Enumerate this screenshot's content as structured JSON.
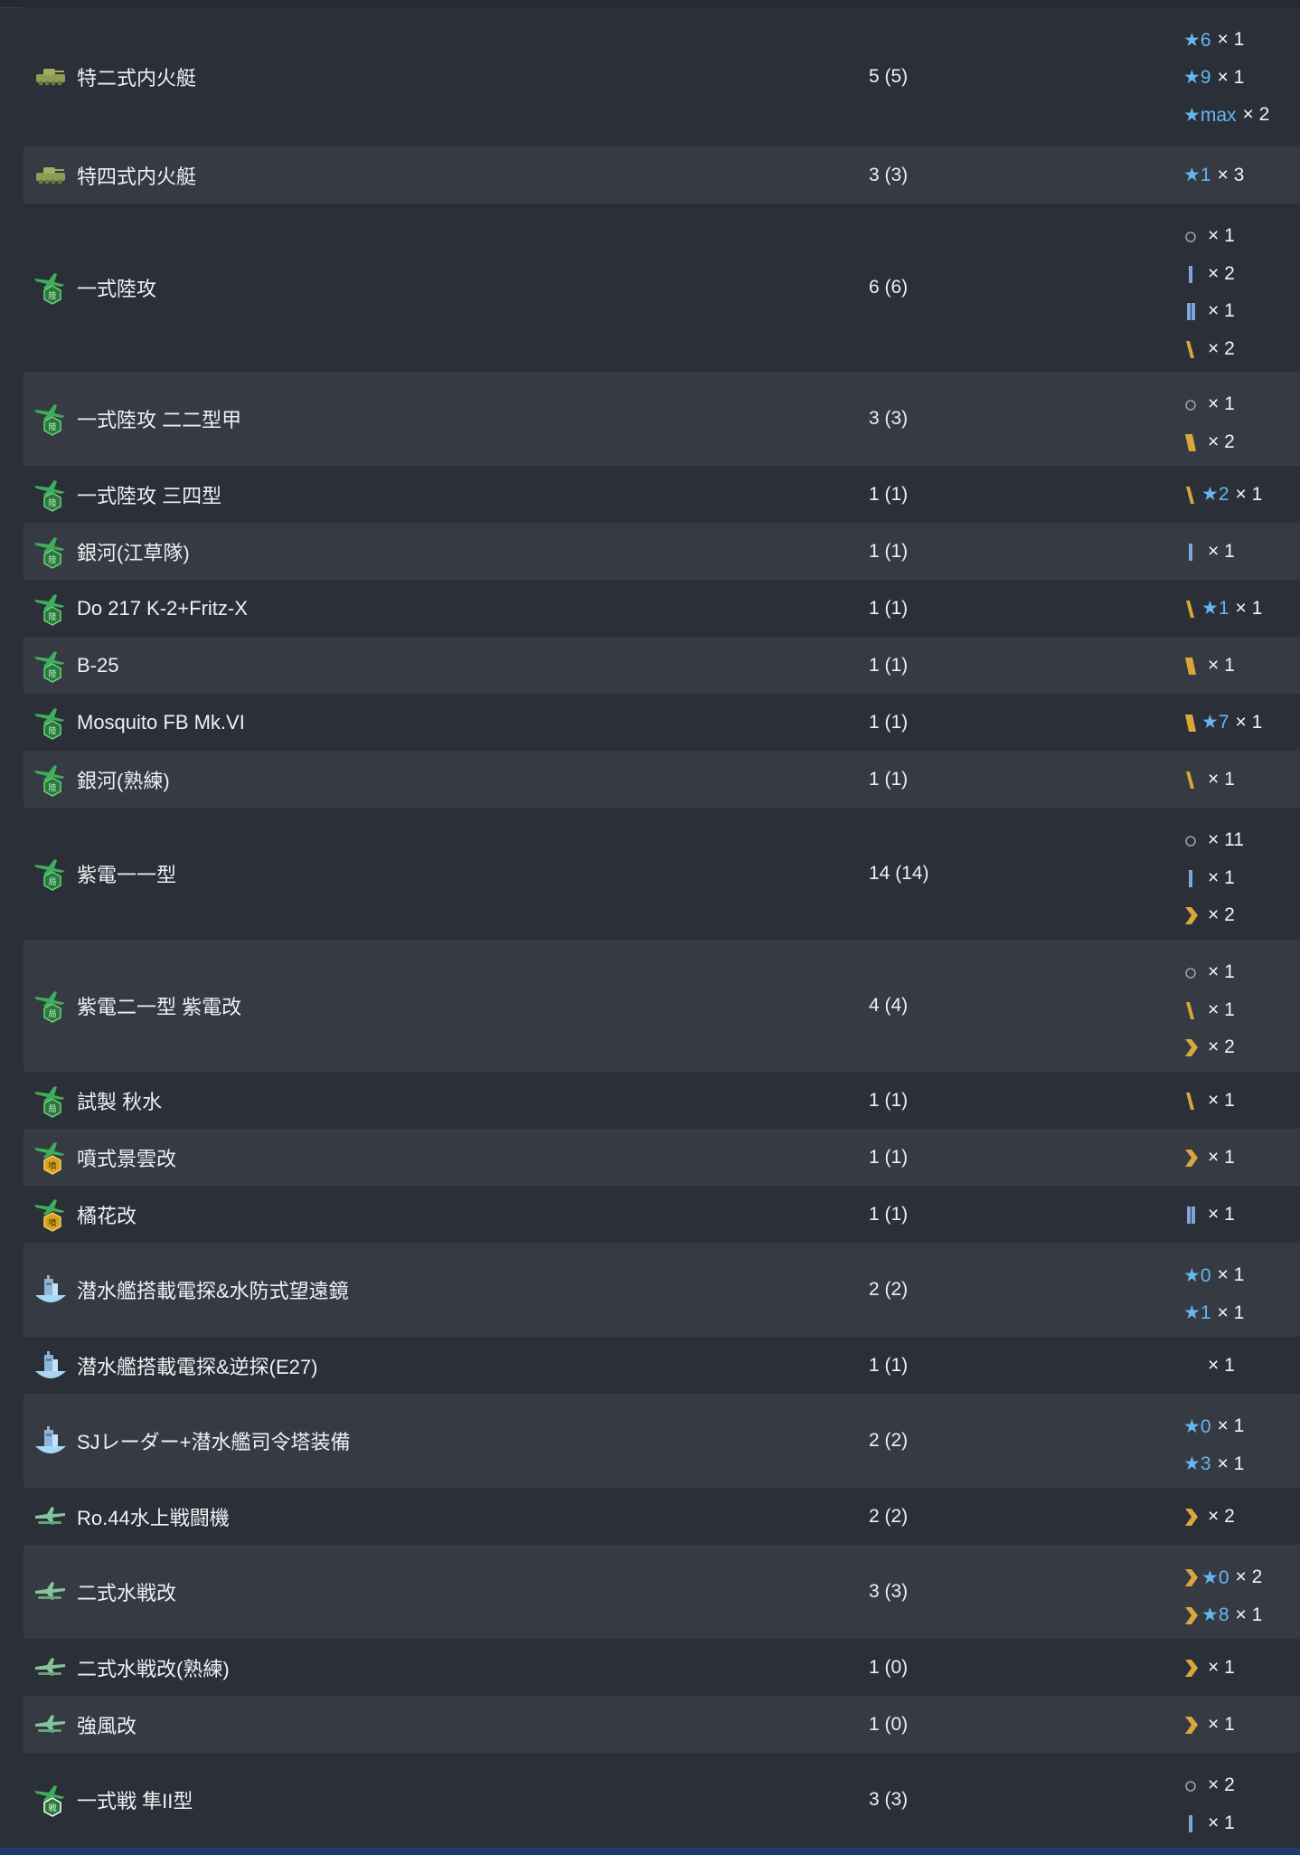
{
  "rows": [
    {
      "name": "特二式内火艇",
      "count": "5 (5)",
      "icon": "amphibious-tank-icon",
      "imps": [
        {
          "prof": "none",
          "star": "★6",
          "qty": "× 1"
        },
        {
          "prof": "none",
          "star": "★9",
          "qty": "× 1"
        },
        {
          "prof": "none",
          "star": "★max",
          "qty": "× 2"
        }
      ]
    },
    {
      "name": "特四式内火艇",
      "count": "3 (3)",
      "icon": "amphibious-tank-icon",
      "imps": [
        {
          "prof": "none",
          "star": "★1",
          "qty": "× 3"
        }
      ]
    },
    {
      "name": "一式陸攻",
      "count": "6 (6)",
      "icon": "land-attacker-icon",
      "imps": [
        {
          "prof": "circle",
          "star": "",
          "qty": "× 1"
        },
        {
          "prof": "bar1",
          "star": "",
          "qty": "× 2"
        },
        {
          "prof": "bar2",
          "star": "",
          "qty": "× 1"
        },
        {
          "prof": "gold1",
          "star": "",
          "qty": "× 2"
        }
      ]
    },
    {
      "name": "一式陸攻 二二型甲",
      "count": "3 (3)",
      "icon": "land-attacker-icon",
      "imps": [
        {
          "prof": "circle",
          "star": "",
          "qty": "× 1"
        },
        {
          "prof": "gold2",
          "star": "",
          "qty": "× 2"
        }
      ]
    },
    {
      "name": "一式陸攻 三四型",
      "count": "1 (1)",
      "icon": "land-attacker-icon",
      "imps": [
        {
          "prof": "gold1",
          "star": "★2",
          "qty": "× 1"
        }
      ]
    },
    {
      "name": "銀河(江草隊)",
      "count": "1 (1)",
      "icon": "land-attacker-icon",
      "imps": [
        {
          "prof": "bar1",
          "star": "",
          "qty": "× 1"
        }
      ]
    },
    {
      "name": "Do 217 K-2+Fritz-X",
      "count": "1 (1)",
      "icon": "land-attacker-icon",
      "imps": [
        {
          "prof": "gold1",
          "star": "★1",
          "qty": "× 1"
        }
      ]
    },
    {
      "name": "B-25",
      "count": "1 (1)",
      "icon": "land-attacker-icon",
      "imps": [
        {
          "prof": "gold2",
          "star": "",
          "qty": "× 1"
        }
      ]
    },
    {
      "name": "Mosquito FB Mk.VI",
      "count": "1 (1)",
      "icon": "land-attacker-icon",
      "imps": [
        {
          "prof": "gold2",
          "star": "★7",
          "qty": "× 1"
        }
      ]
    },
    {
      "name": "銀河(熟練)",
      "count": "1 (1)",
      "icon": "land-attacker-icon",
      "imps": [
        {
          "prof": "gold1",
          "star": "",
          "qty": "× 1"
        }
      ]
    },
    {
      "name": "紫電一一型",
      "count": "14 (14)",
      "icon": "interceptor-icon",
      "imps": [
        {
          "prof": "circle",
          "star": "",
          "qty": "× 11"
        },
        {
          "prof": "bar1",
          "star": "",
          "qty": "× 1"
        },
        {
          "prof": "chevron",
          "star": "",
          "qty": "× 2"
        }
      ]
    },
    {
      "name": "紫電二一型 紫電改",
      "count": "4 (4)",
      "icon": "interceptor-icon",
      "imps": [
        {
          "prof": "circle",
          "star": "",
          "qty": "× 1"
        },
        {
          "prof": "gold1",
          "star": "",
          "qty": "× 1"
        },
        {
          "prof": "chevron",
          "star": "",
          "qty": "× 2"
        }
      ]
    },
    {
      "name": "試製 秋水",
      "count": "1 (1)",
      "icon": "interceptor-icon",
      "imps": [
        {
          "prof": "gold1",
          "star": "",
          "qty": "× 1"
        }
      ]
    },
    {
      "name": "噴式景雲改",
      "count": "1 (1)",
      "icon": "jet-icon",
      "imps": [
        {
          "prof": "chevron",
          "star": "",
          "qty": "× 1"
        }
      ]
    },
    {
      "name": "橘花改",
      "count": "1 (1)",
      "icon": "jet-icon",
      "imps": [
        {
          "prof": "bar2",
          "star": "",
          "qty": "× 1"
        }
      ]
    },
    {
      "name": "潜水艦搭載電探&水防式望遠鏡",
      "count": "2 (2)",
      "icon": "submarine-equipment-icon",
      "imps": [
        {
          "prof": "none",
          "star": "★0",
          "qty": "× 1"
        },
        {
          "prof": "none",
          "star": "★1",
          "qty": "× 1"
        }
      ]
    },
    {
      "name": "潜水艦搭載電探&逆探(E27)",
      "count": "1 (1)",
      "icon": "submarine-equipment-icon",
      "imps": [
        {
          "prof": "blank",
          "star": "",
          "qty": "× 1"
        }
      ]
    },
    {
      "name": "SJレーダー+潜水艦司令塔装備",
      "count": "2 (2)",
      "icon": "submarine-equipment-icon",
      "imps": [
        {
          "prof": "none",
          "star": "★0",
          "qty": "× 1"
        },
        {
          "prof": "none",
          "star": "★3",
          "qty": "× 1"
        }
      ]
    },
    {
      "name": "Ro.44水上戦闘機",
      "count": "2 (2)",
      "icon": "seaplane-fighter-icon",
      "imps": [
        {
          "prof": "chevron",
          "star": "",
          "qty": "× 2"
        }
      ]
    },
    {
      "name": "二式水戦改",
      "count": "3 (3)",
      "icon": "seaplane-fighter-icon",
      "imps": [
        {
          "prof": "chevron",
          "star": "★0",
          "qty": "× 2"
        },
        {
          "prof": "chevron",
          "star": "★8",
          "qty": "× 1"
        }
      ]
    },
    {
      "name": "二式水戦改(熟練)",
      "count": "1 (0)",
      "icon": "seaplane-fighter-icon",
      "imps": [
        {
          "prof": "chevron",
          "star": "",
          "qty": "× 1"
        }
      ]
    },
    {
      "name": "強風改",
      "count": "1 (0)",
      "icon": "seaplane-fighter-icon",
      "imps": [
        {
          "prof": "chevron",
          "star": "",
          "qty": "× 1"
        }
      ]
    },
    {
      "name": "一式戦 隼II型",
      "count": "3 (3)",
      "icon": "land-fighter-icon",
      "imps": [
        {
          "prof": "circle",
          "star": "",
          "qty": "× 2"
        },
        {
          "prof": "bar1",
          "star": "",
          "qty": "× 1"
        }
      ]
    }
  ],
  "colors": {
    "row_dark": "#2b2f37",
    "row_light": "#363a43",
    "star": "#63b8ef",
    "gold": "#d8a63a",
    "blue_bar": "#7fa6dc"
  }
}
